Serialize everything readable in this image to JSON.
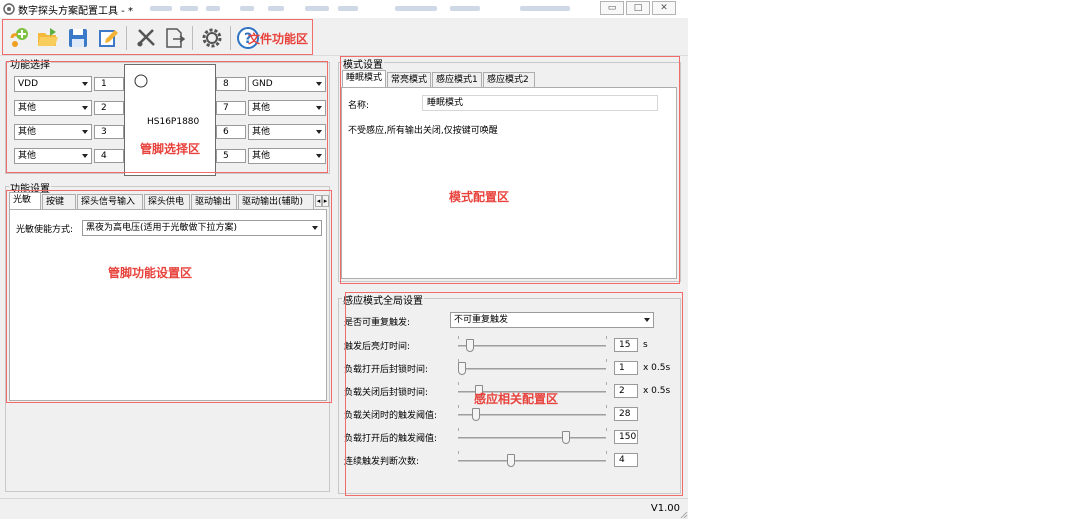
{
  "window": {
    "title": "数字探头方案配置工具 - *",
    "min_glyph": "▭",
    "max_glyph": "□",
    "close_glyph": "✕",
    "version": "V1.00"
  },
  "annotations": {
    "file_area": "文件功能区",
    "pin_select_area": "管脚选择区",
    "pin_func_area": "管脚功能设置区",
    "mode_config_area": "模式配置区",
    "sense_config_area": "感应相关配置区"
  },
  "pin_group": {
    "title": "功能选择",
    "chip_name": "HS16P1880",
    "left": [
      {
        "num": "1",
        "value": "VDD"
      },
      {
        "num": "2",
        "value": "其他"
      },
      {
        "num": "3",
        "value": "其他"
      },
      {
        "num": "4",
        "value": "其他"
      }
    ],
    "right": [
      {
        "num": "8",
        "value": "GND"
      },
      {
        "num": "7",
        "value": "其他"
      },
      {
        "num": "6",
        "value": "其他"
      },
      {
        "num": "5",
        "value": "其他"
      }
    ]
  },
  "func_group": {
    "title": "功能设置",
    "tabs": [
      "光敏",
      "按键",
      "探头信号输入",
      "探头供电",
      "驱动输出",
      "驱动输出(辅助)"
    ],
    "scroll_left": "◂",
    "scroll_right": "▸",
    "photo_label": "光敏使能方式:",
    "photo_value": "黑夜为高电压(适用于光敏做下拉方案)"
  },
  "mode_group": {
    "title": "模式设置",
    "tabs": [
      "睡眠模式",
      "常亮模式",
      "感应模式1",
      "感应模式2"
    ],
    "name_label": "名称:",
    "name_value": "睡眠模式",
    "description": "不受感应,所有输出关闭,仅按键可唤醒"
  },
  "sense_group": {
    "title": "感应模式全局设置",
    "retrigger_label": "是否可重复触发:",
    "retrigger_value": "不可重复触发",
    "rows": [
      {
        "label": "触发后亮灯时间:",
        "value": "15",
        "unit": "s",
        "level": 0.06
      },
      {
        "label": "负载打开后封锁时间:",
        "value": "1",
        "unit": "x 0.5s",
        "level": 0.0
      },
      {
        "label": "负载关闭后封锁时间:",
        "value": "2",
        "unit": "x 0.5s",
        "level": 0.12
      },
      {
        "label": "负载关闭时的触发阈值:",
        "value": "28",
        "unit": "",
        "level": 0.1
      },
      {
        "label": "负载打开后的触发阈值:",
        "value": "150",
        "unit": "",
        "level": 0.74
      },
      {
        "label": "连续触发判断次数:",
        "value": "4",
        "unit": "",
        "level": 0.35
      }
    ]
  },
  "colors": {
    "annotation": "#e8423c",
    "window_bg": "#f0f0f0"
  }
}
